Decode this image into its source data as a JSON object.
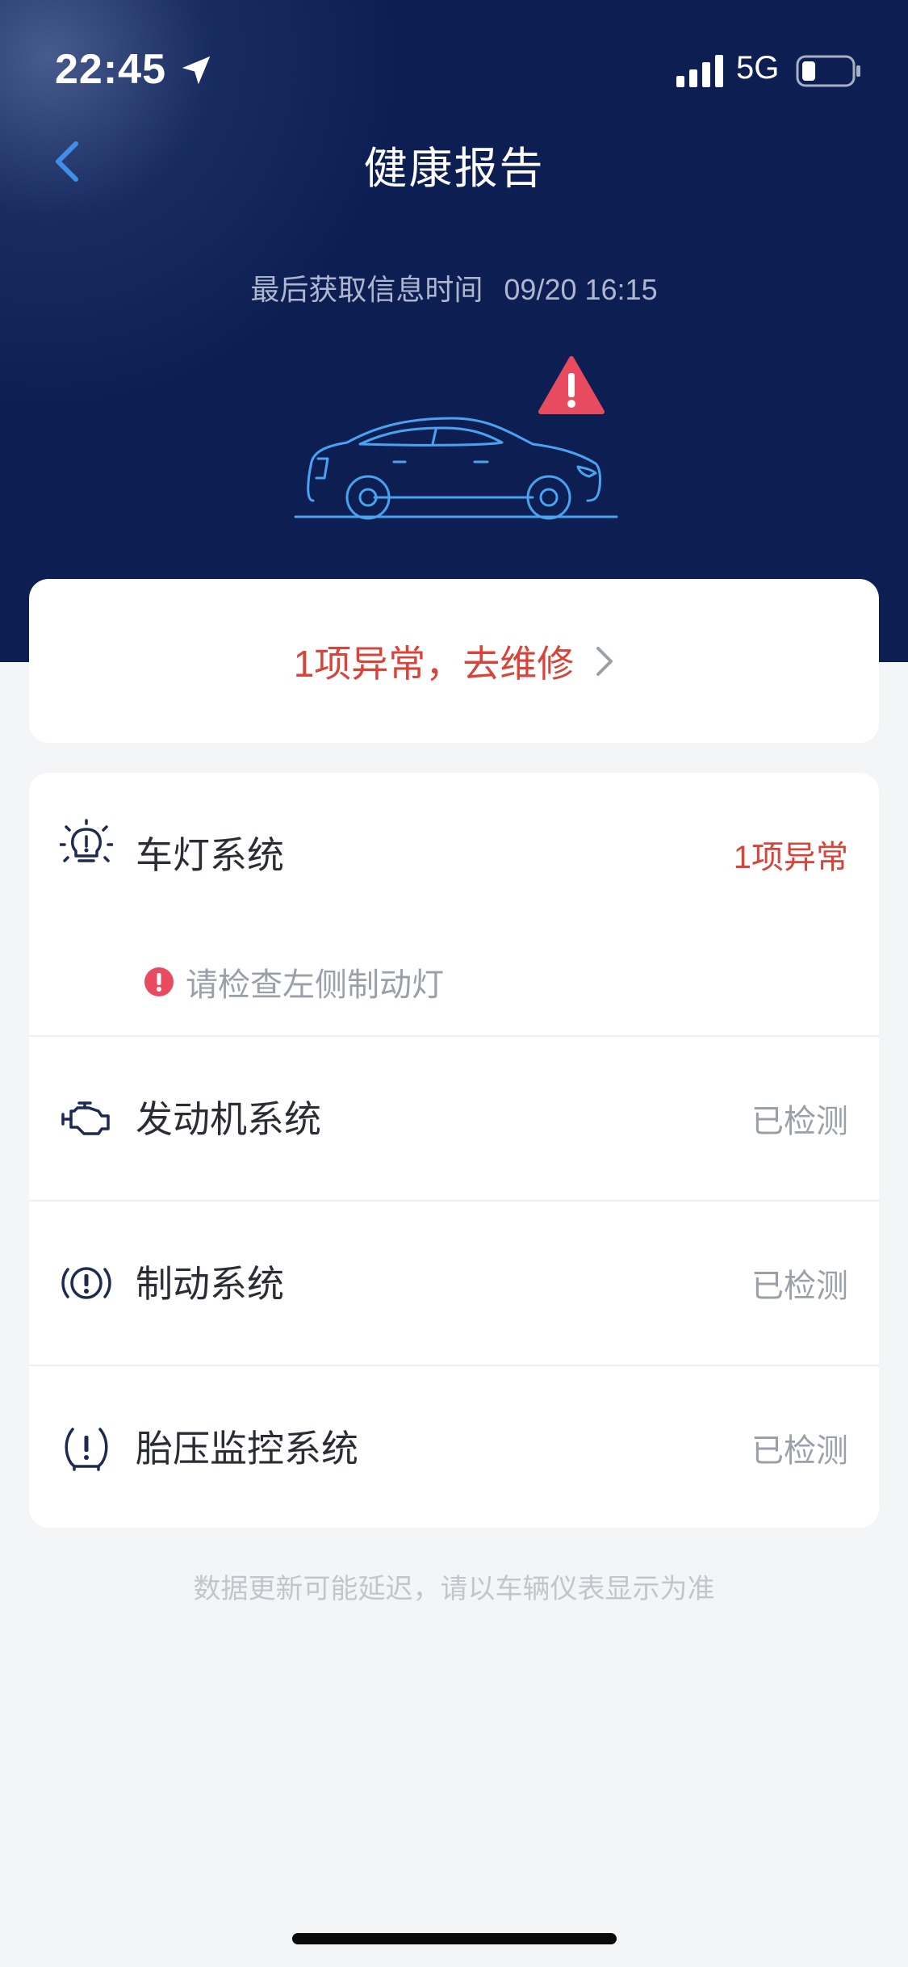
{
  "status_bar": {
    "time": "22:45",
    "network": "5G"
  },
  "nav": {
    "title": "健康报告",
    "back_icon": "chevron-left-icon"
  },
  "header": {
    "fetch_label": "最后获取信息时间",
    "fetch_time": "09/20 16:15"
  },
  "summary": {
    "text": "1项异常，去维修"
  },
  "systems": [
    {
      "name": "车灯系统",
      "status": "1项异常",
      "icon": "headlight-icon",
      "alert": true,
      "sub_message": "请检查左侧制动灯"
    },
    {
      "name": "发动机系统",
      "status": "已检测",
      "icon": "engine-icon"
    },
    {
      "name": "制动系统",
      "status": "已检测",
      "icon": "brake-icon"
    },
    {
      "name": "胎压监控系统",
      "status": "已检测",
      "icon": "tire-pressure-icon"
    }
  ],
  "footnote": "数据更新可能延迟，请以车辆仪表显示为准",
  "colors": {
    "header_bg": "#0d1f52",
    "alert": "#d8443a",
    "accent": "#3f8fe8"
  }
}
